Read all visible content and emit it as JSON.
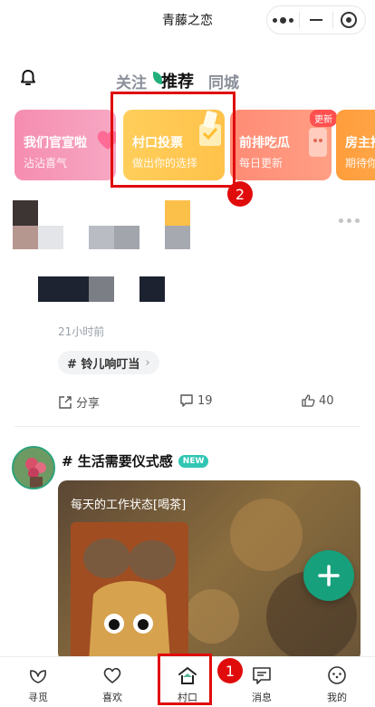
{
  "header": {
    "app_title": "青藤之恋"
  },
  "tabs": [
    {
      "label": "关注"
    },
    {
      "label": "推荐",
      "active": true
    },
    {
      "label": "同城"
    }
  ],
  "feature_cards": [
    {
      "title": "我们官宣啦",
      "subtitle": "沾沾喜气"
    },
    {
      "title": "村口投票",
      "subtitle": "做出你的选择"
    },
    {
      "title": "前排吃瓜",
      "subtitle": "每日更新",
      "badge": "更新"
    },
    {
      "title": "房主推",
      "subtitle": "期待你"
    }
  ],
  "annotations": {
    "marker_1": "1",
    "marker_2": "2"
  },
  "post1": {
    "time": "21小时前",
    "tag": "# 铃儿响叮当",
    "share_label": "分享",
    "comment_count": "19",
    "like_count": "40"
  },
  "post2": {
    "topic": "# 生活需要仪式感",
    "new_badge": "NEW",
    "photo_title": "每天的工作状态[喝茶]"
  },
  "bottom_nav": [
    {
      "label": "寻觅",
      "icon": "leaf-icon"
    },
    {
      "label": "喜欢",
      "icon": "heart-icon"
    },
    {
      "label": "村口",
      "icon": "home-icon"
    },
    {
      "label": "消息",
      "icon": "message-icon"
    },
    {
      "label": "我的",
      "icon": "smile-icon"
    }
  ],
  "colors": {
    "accent": "#17a07c",
    "highlight": "#e00c0c",
    "tab_inactive": "#8a8f99"
  }
}
